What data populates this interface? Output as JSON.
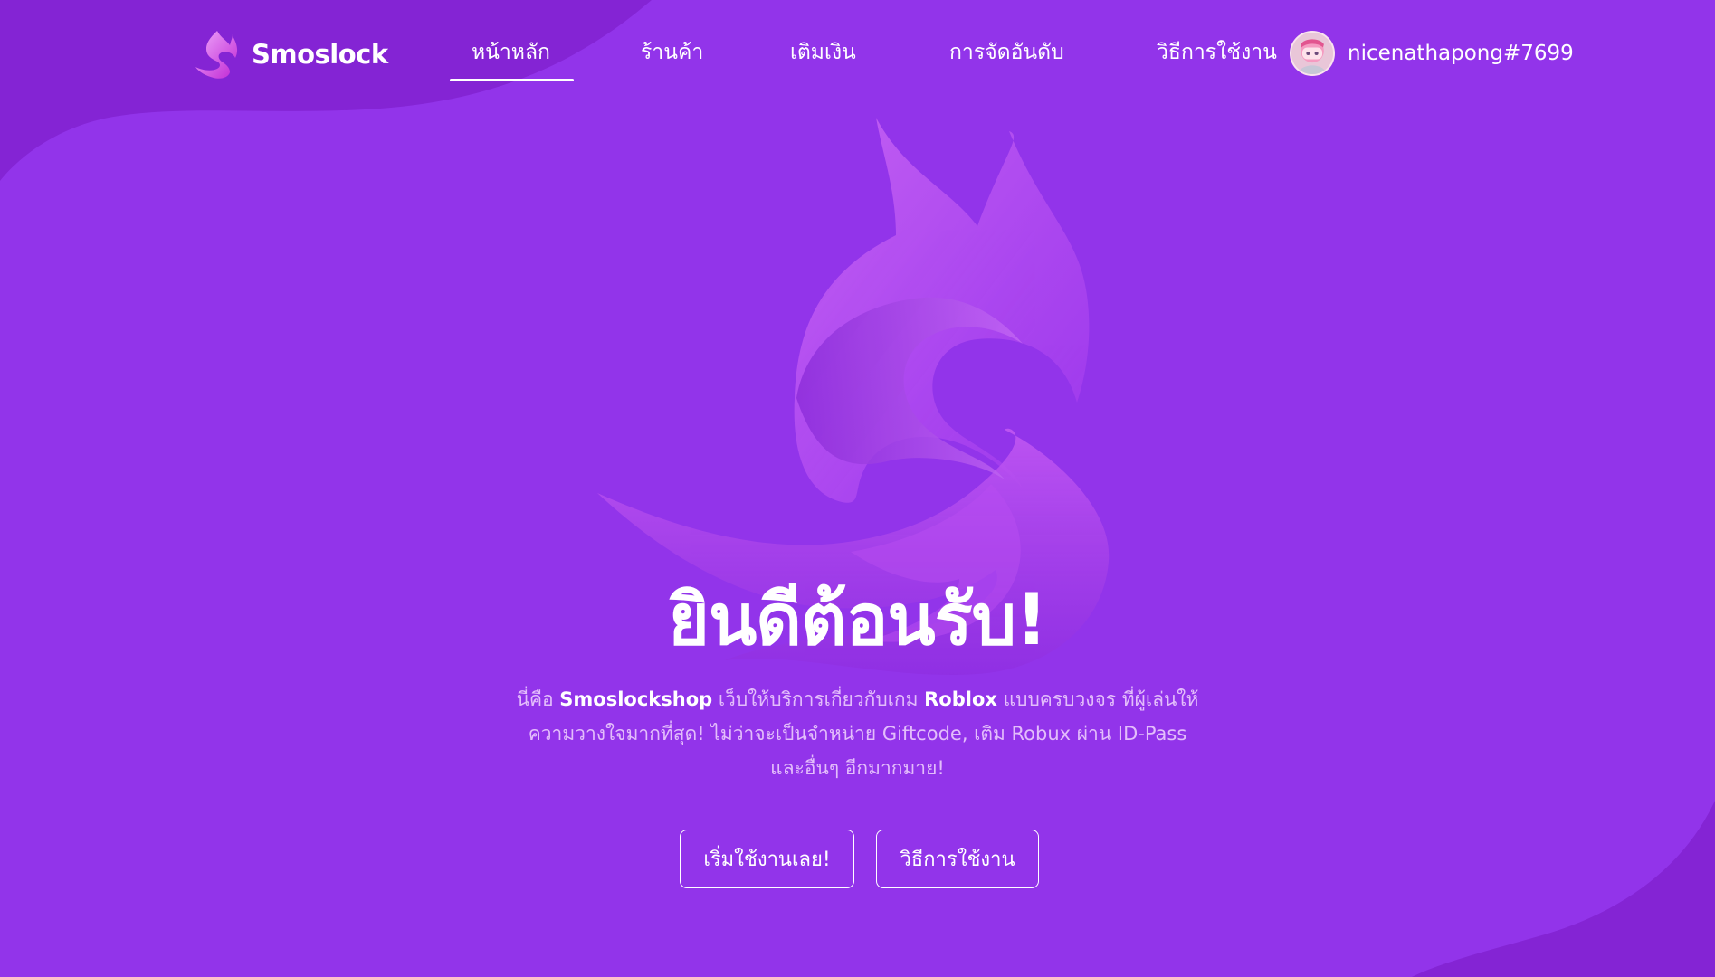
{
  "brand": {
    "name": "Smoslock",
    "logo_icon": "flame-s-logo-icon"
  },
  "nav": {
    "items": [
      {
        "label": "หน้าหลัก",
        "active": true
      },
      {
        "label": "ร้านค้า",
        "active": false
      },
      {
        "label": "เติมเงิน",
        "active": false
      },
      {
        "label": "การจัดอันดับ",
        "active": false
      },
      {
        "label": "วิธีการใช้งาน",
        "active": false
      }
    ]
  },
  "user": {
    "name": "nicenathapong#7699",
    "avatar_icon": "user-avatar-icon"
  },
  "hero": {
    "title": "ยินดีต้อนรับ!",
    "desc_1": "นี่คือ ",
    "desc_brand": "Smoslockshop",
    "desc_2": " เว็บให้บริการเกี่ยวกับเกม ",
    "desc_game": "Roblox",
    "desc_3": " แบบครบวงจร ที่ผู้เล่นให้ความวางใจมากที่สุด! ไม่ว่าจะเป็นจำหน่าย Giftcode, เติม Robux ผ่าน ID-Pass และอื่นๆ อีกมากมาย!",
    "btn_start": "เริ่มใช้งานเลย!",
    "btn_howto": "วิธีการใช้งาน"
  },
  "colors": {
    "background": "#9234ea",
    "wave": "#7e22ce",
    "accent_pink": "#e879f9",
    "text": "#ffffff"
  }
}
